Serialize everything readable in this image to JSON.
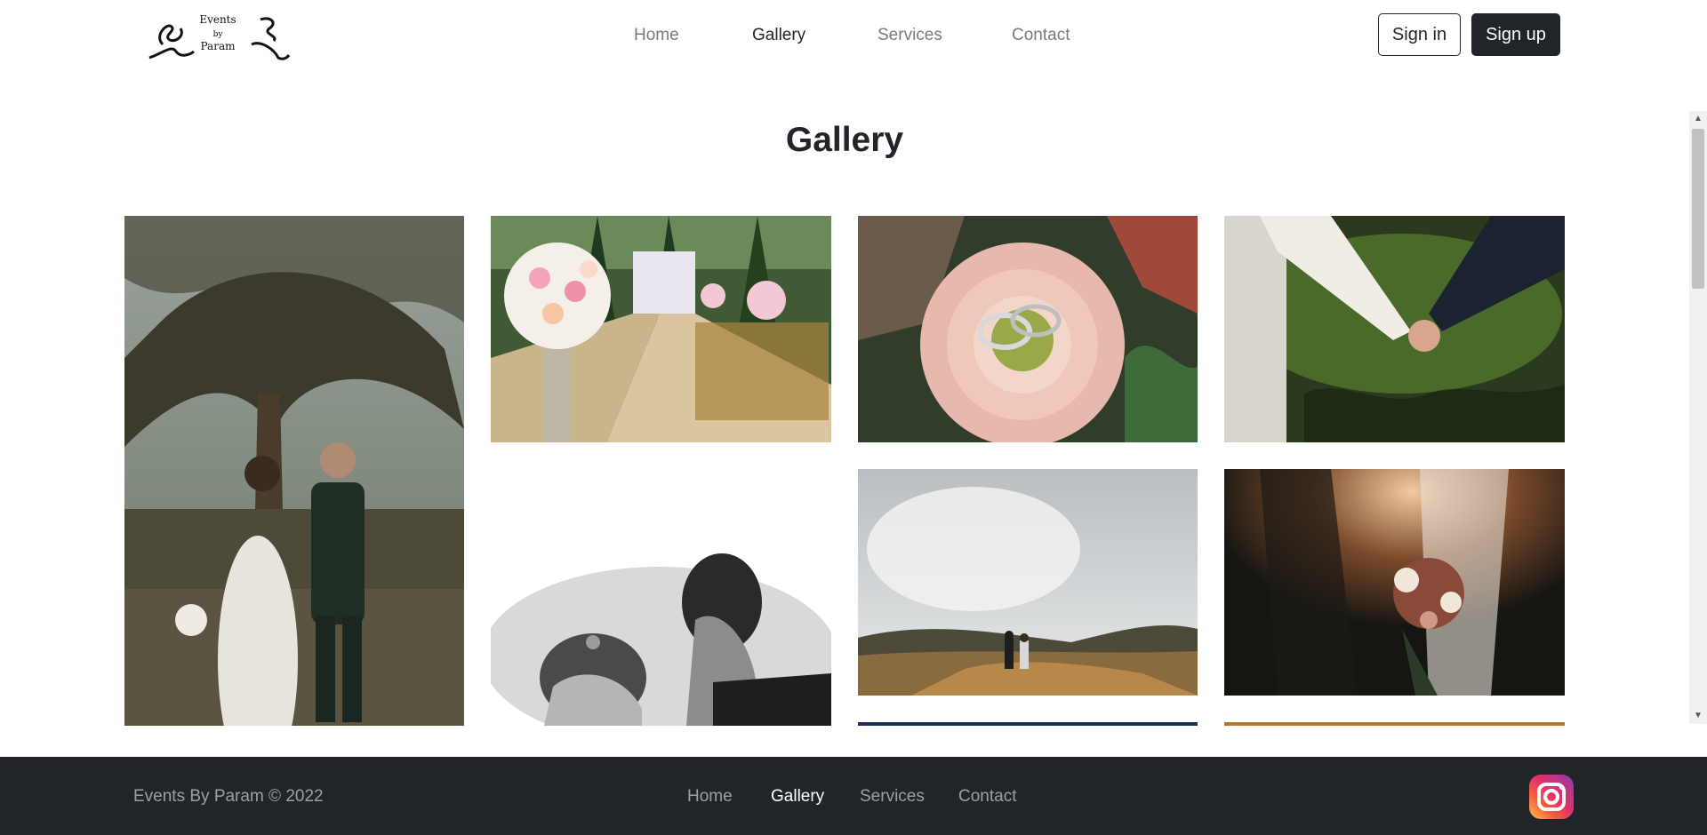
{
  "brand": {
    "logo_line1": "Events",
    "logo_line2": "by",
    "logo_line3": "Param"
  },
  "nav": {
    "items": [
      {
        "label": "Home",
        "active": false
      },
      {
        "label": "Gallery",
        "active": true
      },
      {
        "label": "Services",
        "active": false
      },
      {
        "label": "Contact",
        "active": false
      }
    ]
  },
  "auth": {
    "sign_in": "Sign in",
    "sign_up": "Sign up"
  },
  "page": {
    "title": "Gallery"
  },
  "gallery": {
    "photos": [
      {
        "name": "couple-palm-tree-photo",
        "icon": "photo"
      },
      {
        "name": "aisle-flowers-photo",
        "icon": "photo"
      },
      {
        "name": "rings-on-flower-photo",
        "icon": "photo"
      },
      {
        "name": "holding-hands-photo",
        "icon": "photo"
      },
      {
        "name": "black-white-couple-photo",
        "icon": "photo"
      },
      {
        "name": "couple-hillside-photo",
        "icon": "photo"
      },
      {
        "name": "bouquet-sunlight-photo",
        "icon": "photo"
      }
    ]
  },
  "footer": {
    "copyright": "Events By Param © 2022",
    "nav": [
      {
        "label": "Home",
        "active": false
      },
      {
        "label": "Gallery",
        "active": true
      },
      {
        "label": "Services",
        "active": false
      },
      {
        "label": "Contact",
        "active": false
      }
    ],
    "social_icon": "instagram-icon"
  },
  "colors": {
    "dark": "#212529",
    "muted": "#7a7a7a",
    "footer_text": "#9aa0a6"
  }
}
